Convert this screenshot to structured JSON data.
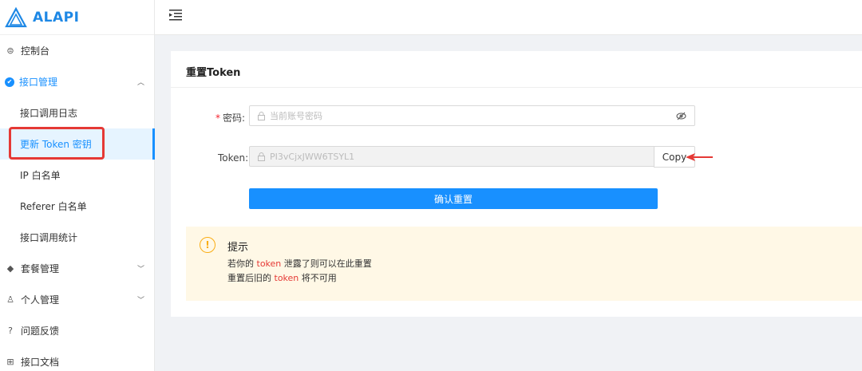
{
  "app": {
    "logo_text": "ALAPI",
    "brand_color": "#1e88e5"
  },
  "sidebar": {
    "items": [
      {
        "label": "控制台",
        "icon": "dashboard-icon"
      },
      {
        "label": "接口管理",
        "icon": "api-icon",
        "expanded": true
      },
      {
        "label": "套餐管理",
        "icon": "package-icon"
      },
      {
        "label": "个人管理",
        "icon": "user-icon"
      },
      {
        "label": "问题反馈",
        "icon": "question-icon"
      },
      {
        "label": "接口文档",
        "icon": "docs-icon"
      }
    ],
    "sub_items": [
      {
        "label": "接口调用日志"
      },
      {
        "label": "更新 Token 密钥",
        "active": true
      },
      {
        "label": "IP 白名单"
      },
      {
        "label": "Referer 白名单"
      },
      {
        "label": "接口调用统计"
      }
    ]
  },
  "card": {
    "title": "重置Token",
    "password_label": "密码",
    "password_placeholder": "当前账号密码",
    "token_label": "Token",
    "token_value": "PI3vCjxJWW6TSYL1",
    "copy_label": "Copy",
    "confirm_label": "确认重置"
  },
  "notice": {
    "title": "提示",
    "line1_pre": "若你的 ",
    "line1_hl": "token",
    "line1_post": " 泄露了则可以在此重置",
    "line2_pre": "重置后旧的 ",
    "line2_hl": "token",
    "line2_post": " 将不可用"
  },
  "colors": {
    "primary": "#1890ff",
    "highlight_red": "#e53935",
    "notice_bg": "#fff8e6"
  }
}
